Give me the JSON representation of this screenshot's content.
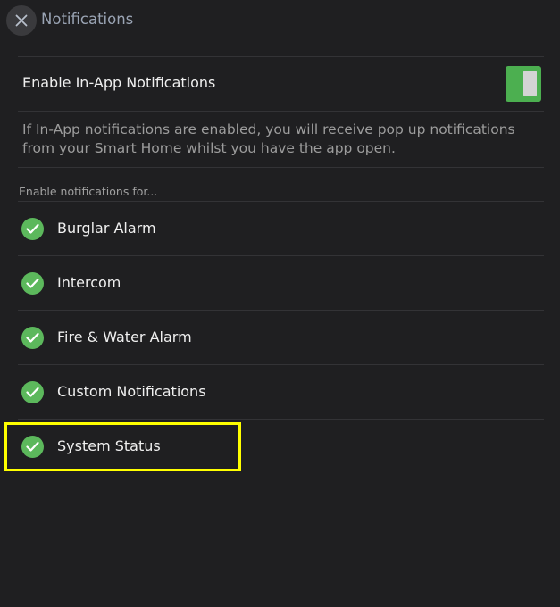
{
  "header": {
    "title": "Notifications",
    "close_icon": "close-icon"
  },
  "in_app": {
    "label": "Enable In-App Notifications",
    "enabled": true,
    "description": "If In-App notifications are enabled, you will receive pop up notifications from your Smart Home whilst you have the app open."
  },
  "section_label": "Enable notifications for...",
  "items": [
    {
      "label": "Burglar Alarm",
      "checked": true,
      "icon": "check-circle-icon"
    },
    {
      "label": "Intercom",
      "checked": true,
      "icon": "check-circle-icon"
    },
    {
      "label": "Fire & Water Alarm",
      "checked": true,
      "icon": "check-circle-icon"
    },
    {
      "label": "Custom Notifications",
      "checked": true,
      "icon": "check-circle-icon"
    },
    {
      "label": "System Status",
      "checked": true,
      "icon": "check-circle-icon"
    }
  ],
  "colors": {
    "background": "#1f1f21",
    "accent_green": "#4caf50",
    "check_green": "#5cb85c",
    "highlight": "#ffff00"
  }
}
